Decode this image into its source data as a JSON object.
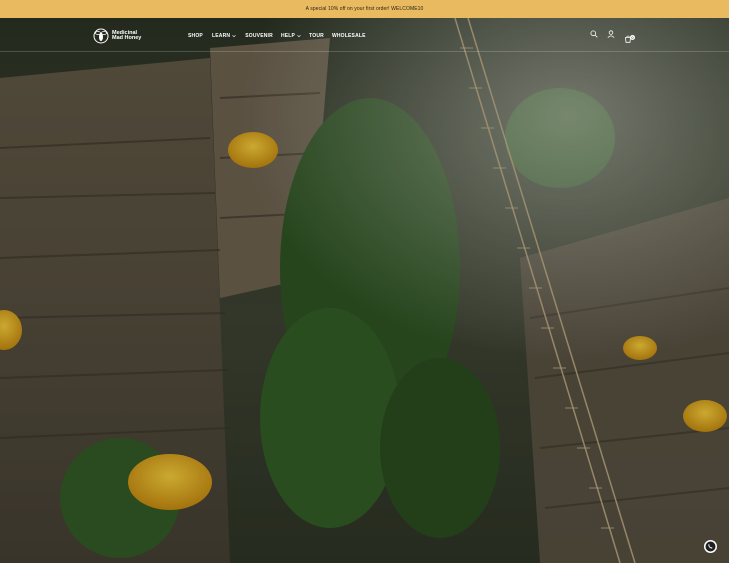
{
  "announcement": {
    "text": "A special 10% off on your first order! WELCOME10"
  },
  "brand": {
    "line1": "Medicinal",
    "line2": "Mad Honey"
  },
  "nav": [
    {
      "label": "SHOP"
    },
    {
      "label": "LEARN"
    },
    {
      "label": "SOUVENIR"
    },
    {
      "label": "HELP"
    },
    {
      "label": "TOUR"
    },
    {
      "label": "WHOLESALE"
    }
  ],
  "header_icons": [
    "search-icon",
    "account-icon",
    "cart-icon"
  ],
  "cart": {
    "count": "0"
  },
  "colors": {
    "announcement_bg": "#e9ba60",
    "honey": "#e7b325",
    "foliage": "#3d6b2c"
  },
  "floating": {
    "icon": "whatsapp-icon"
  }
}
